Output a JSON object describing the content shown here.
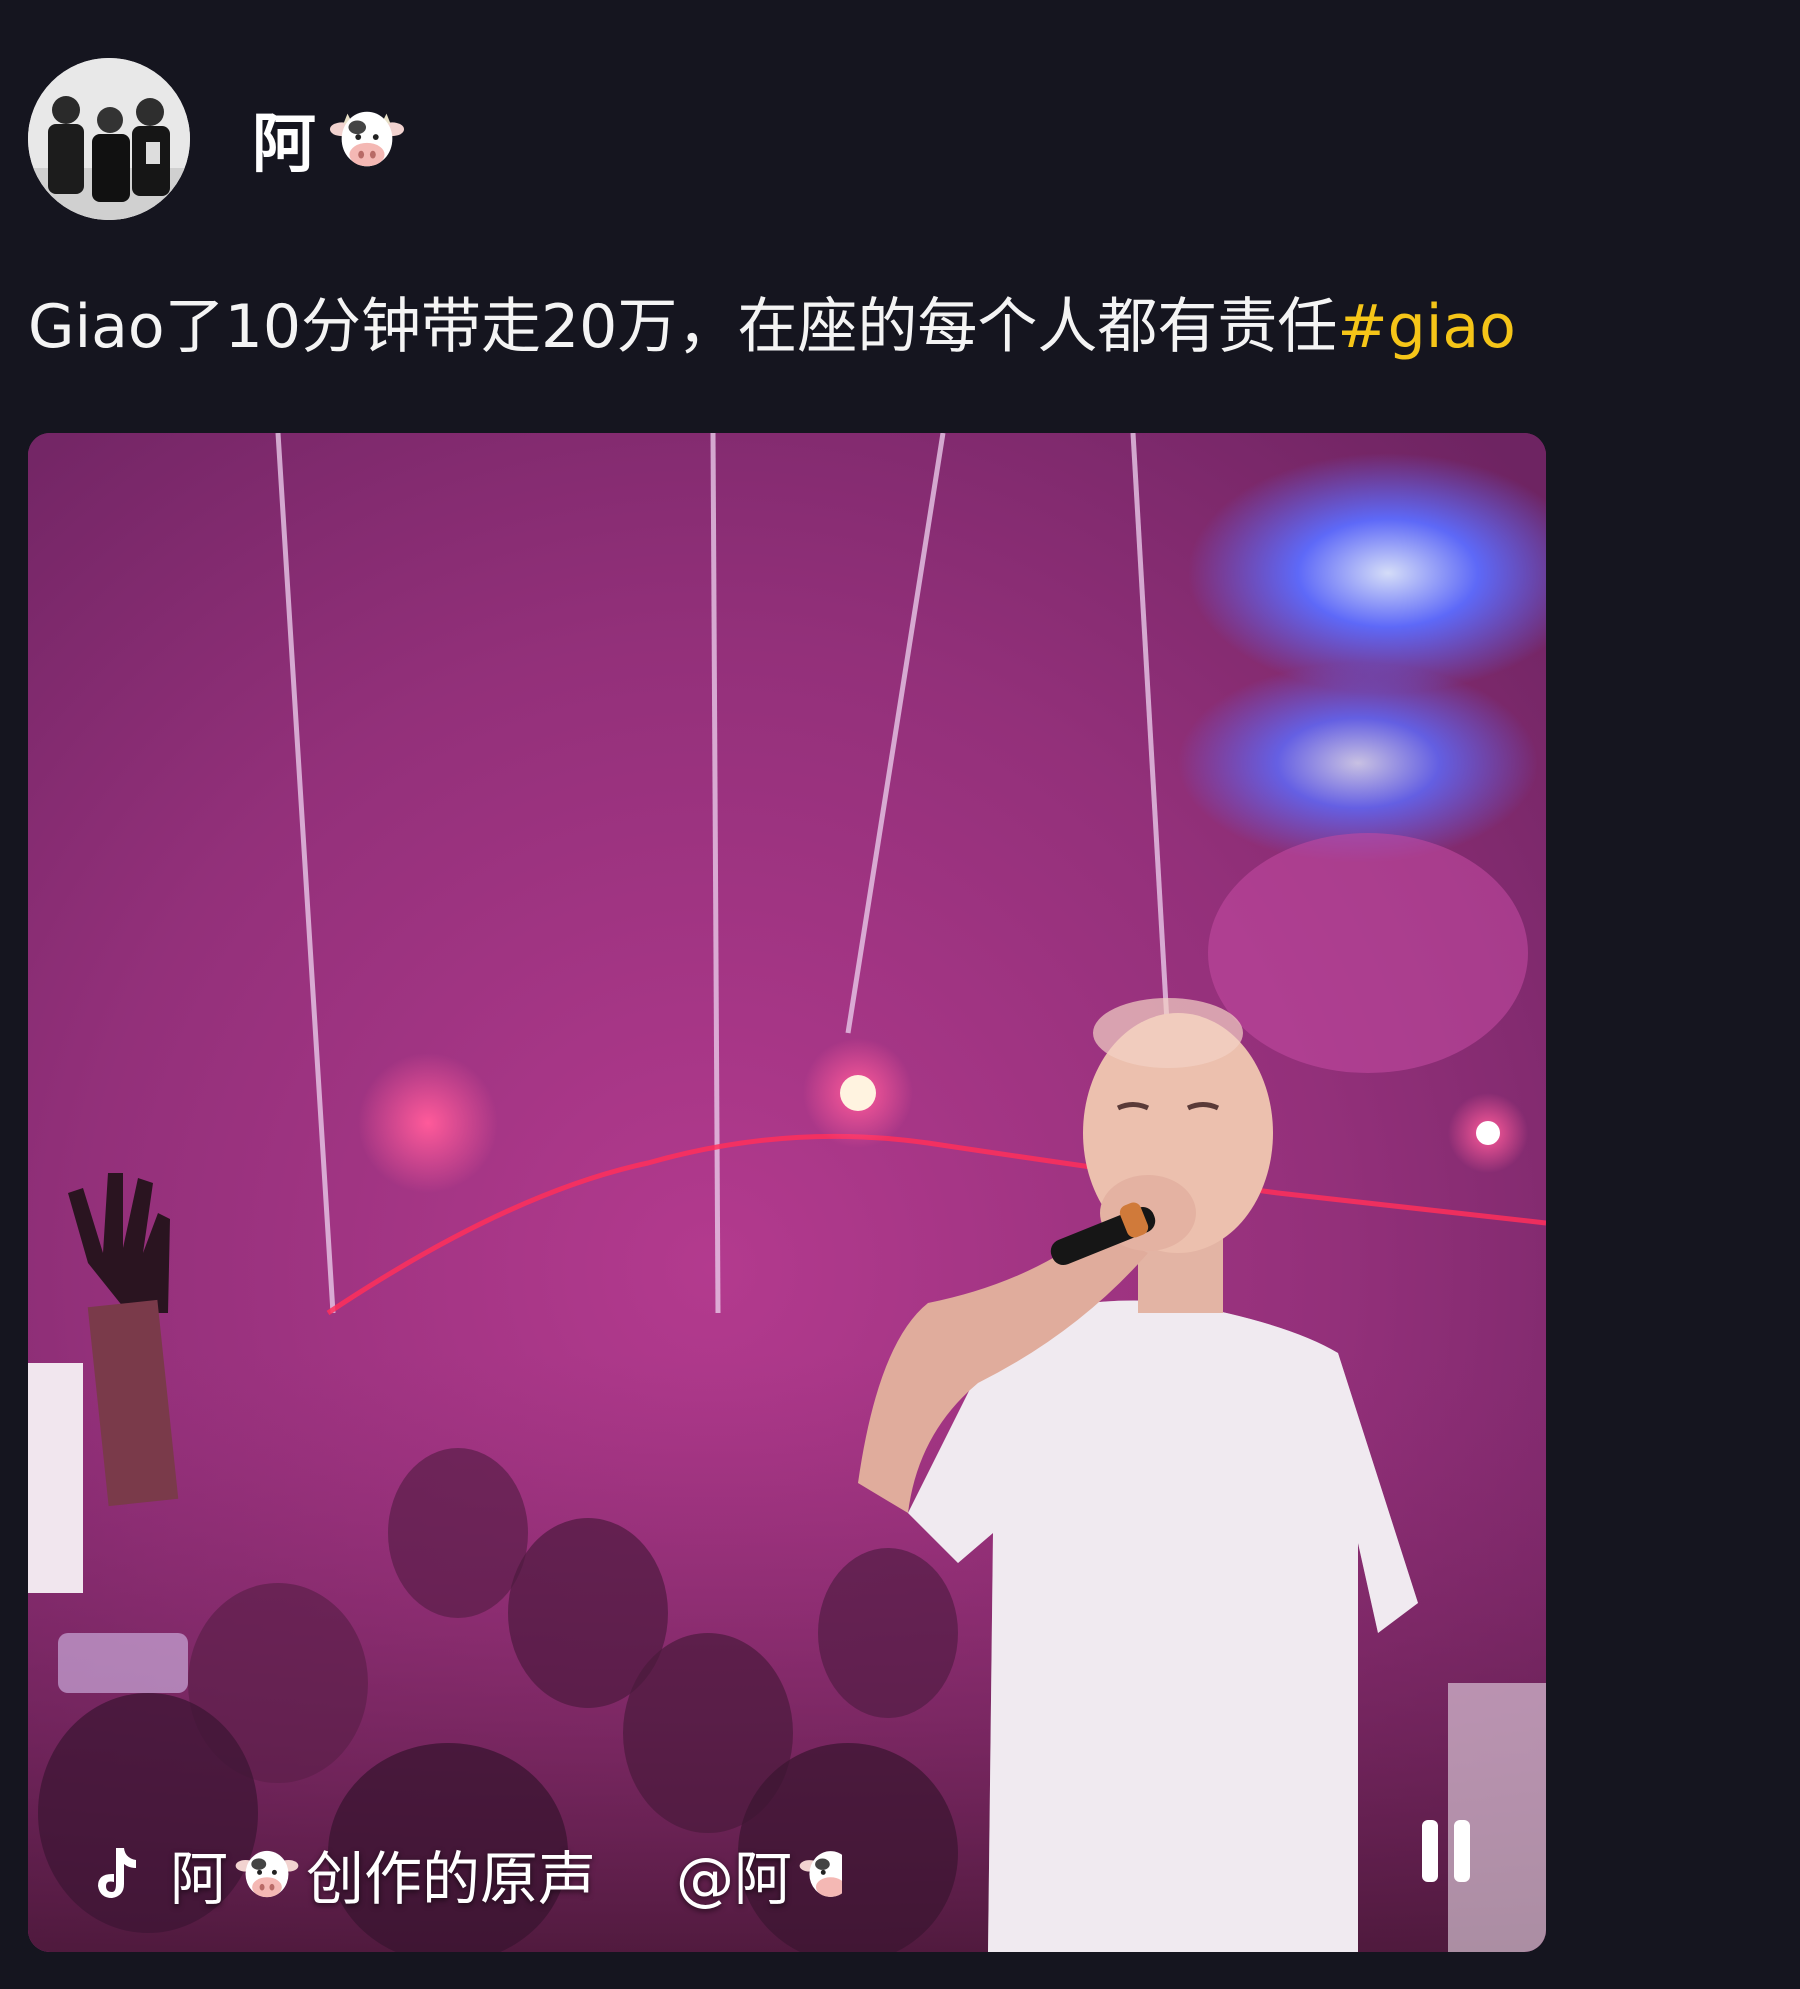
{
  "post": {
    "author": {
      "name": "阿",
      "emoji": "cow-face-emoji"
    },
    "text": "Giao了10分钟带走20万，在座的每个人都有责任",
    "hashtag": "#giao"
  },
  "video": {
    "sound": {
      "icon": "tiktok-icon",
      "author_prefix": "阿",
      "suffix": "创作的原声"
    },
    "mention": {
      "prefix": "@阿"
    },
    "controls": {
      "state_icon": "pause-icon"
    }
  },
  "colors": {
    "background": "#15151f",
    "hashtag": "#f5c518",
    "stage_pink": "#9b2f79"
  }
}
